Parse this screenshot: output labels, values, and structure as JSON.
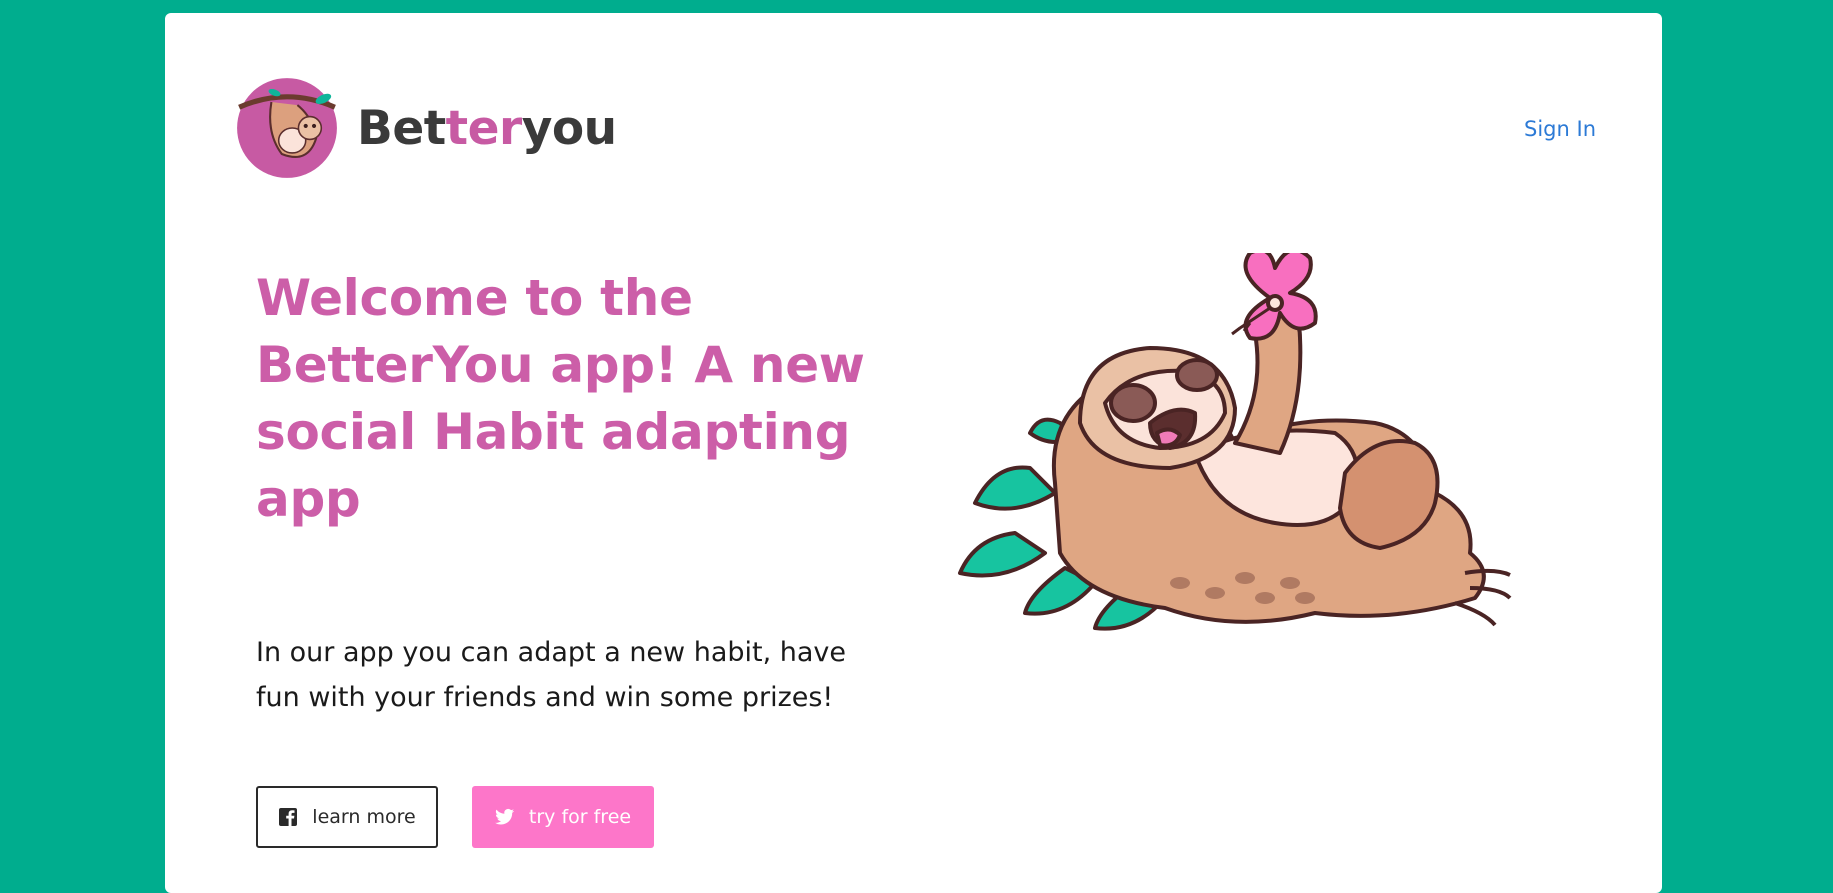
{
  "brand": {
    "prefix": "Bet",
    "accent": "ter",
    "suffix": "you"
  },
  "nav": {
    "signin_label": "Sign In"
  },
  "hero": {
    "headline": "Welcome to the BetterYou app! A new social Habit adapting app",
    "lead": "In our app you can adapt a new habit, have fun with your friends and win some prizes!"
  },
  "buttons": {
    "learn_label": "learn more",
    "try_label": "try for free"
  },
  "icons": {
    "logo": "sloth-logo-icon",
    "learn": "facebook-icon",
    "try": "twitter-icon",
    "illustration": "sleeping-sloth-illustration"
  },
  "colors": {
    "background": "#00ad8e",
    "brand_accent": "#cc5ea8",
    "link": "#2c7ad6",
    "cta": "#fd76c9"
  }
}
